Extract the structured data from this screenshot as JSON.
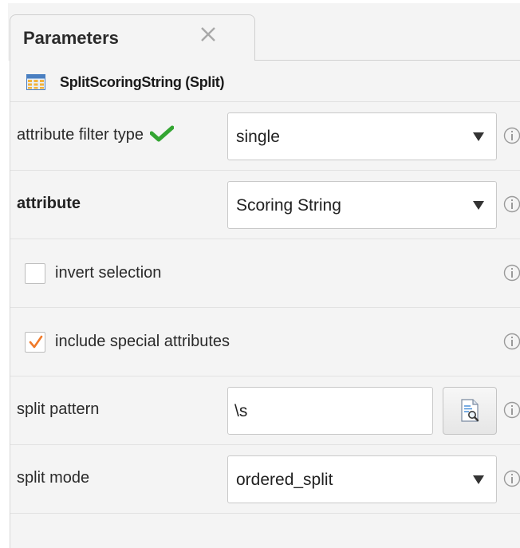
{
  "tab": {
    "title": "Parameters",
    "close_icon": "close-icon"
  },
  "operator": {
    "icon": "split-operator-icon",
    "title": "SplitScoringString (Split)"
  },
  "params": {
    "attribute_filter_type": {
      "label": "attribute filter type",
      "status_icon": "check-icon",
      "value": "single"
    },
    "attribute": {
      "label": "attribute",
      "value": "Scoring String"
    },
    "invert_selection": {
      "label": "invert selection",
      "checked": false
    },
    "include_special_attributes": {
      "label": "include special attributes",
      "checked": true
    },
    "split_pattern": {
      "label": "split pattern",
      "value": "\\s",
      "button_icon": "regex-editor-icon"
    },
    "split_mode": {
      "label": "split mode",
      "value": "ordered_split"
    }
  },
  "colors": {
    "check_green": "#33a532",
    "checkbox_orange": "#f07a2a",
    "icon_gray": "#9a9a9a"
  }
}
